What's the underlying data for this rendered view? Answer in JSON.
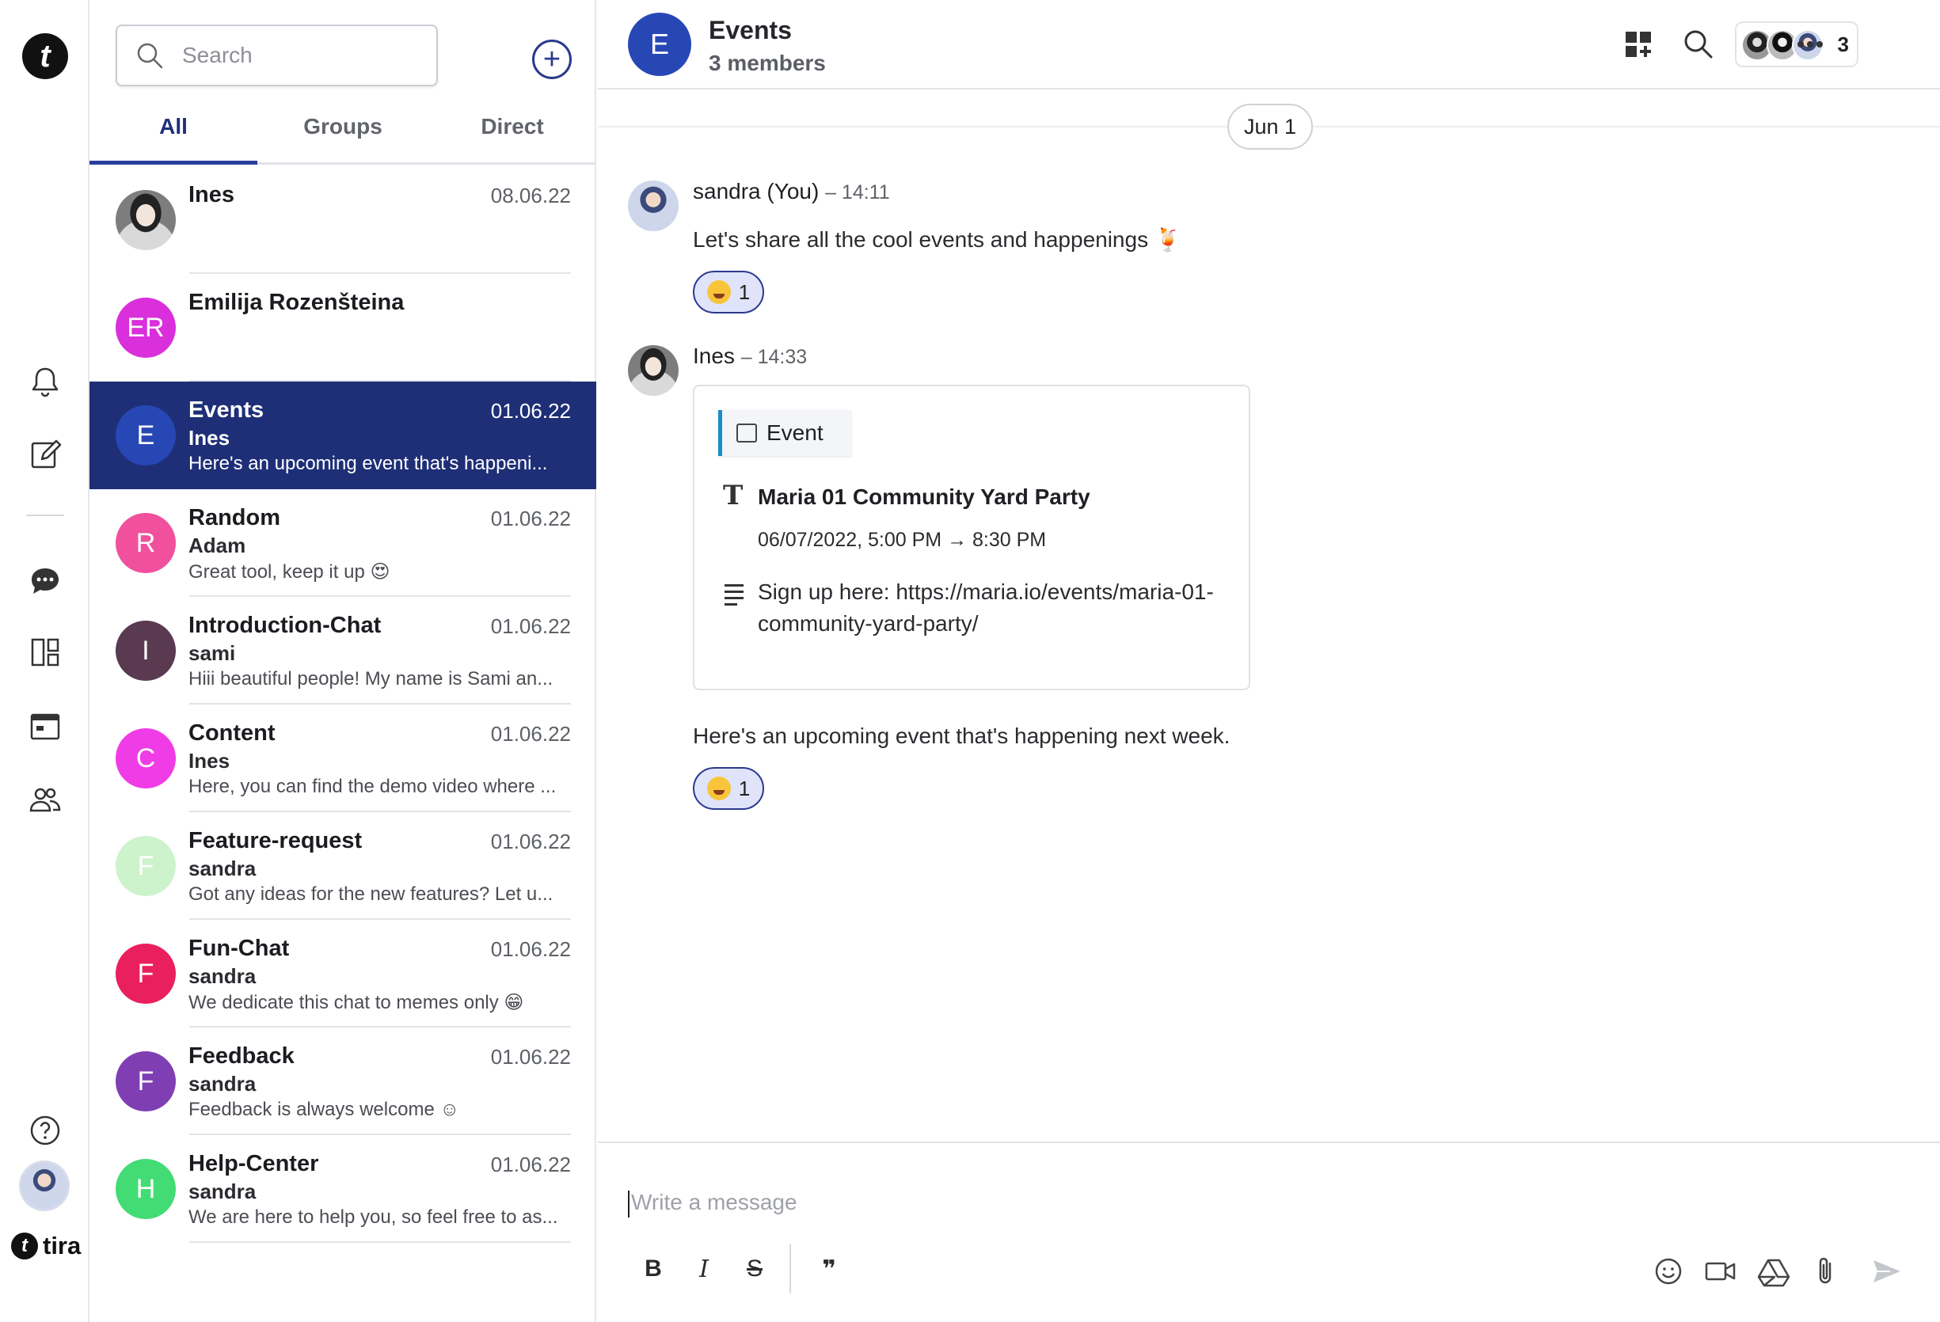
{
  "rail": {
    "logo_letter": "t",
    "brand_name": "tira",
    "icons": [
      "bell-icon",
      "compose-icon",
      "chat-bubble-icon",
      "boards-icon",
      "calendar-icon",
      "people-icon",
      "help-icon"
    ]
  },
  "list": {
    "search_placeholder": "Search",
    "tabs": [
      {
        "label": "All",
        "active": true
      },
      {
        "label": "Groups",
        "active": false
      },
      {
        "label": "Direct",
        "active": false
      }
    ],
    "conversations": [
      {
        "title": "Ines",
        "date": "08.06.22",
        "sender": "",
        "preview": "",
        "initials": "",
        "color": "",
        "photo": true
      },
      {
        "title": "Emilija Rozenšteina",
        "date": "",
        "sender": "",
        "preview": "",
        "initials": "ER",
        "color": "#d930dc"
      },
      {
        "title": "Events",
        "date": "01.06.22",
        "sender": "Ines",
        "preview": "Here's an upcoming event that's happeni...",
        "initials": "E",
        "color": "#2747b5",
        "active": true
      },
      {
        "title": "Random",
        "date": "01.06.22",
        "sender": "Adam",
        "preview": "Great tool, keep it up 😍",
        "initials": "R",
        "color": "#f0509c"
      },
      {
        "title": "Introduction-Chat",
        "date": "01.06.22",
        "sender": "sami",
        "preview": "Hiii beautiful people! My name is Sami an...",
        "initials": "I",
        "color": "#5a3a50"
      },
      {
        "title": "Content",
        "date": "01.06.22",
        "sender": "Ines",
        "preview": "Here, you can find the demo video where ...",
        "initials": "C",
        "color": "#f03ce6"
      },
      {
        "title": "Feature-request",
        "date": "01.06.22",
        "sender": "sandra",
        "preview": "Got any ideas for the new features? Let u...",
        "initials": "F",
        "color": "#cdf3cc"
      },
      {
        "title": "Fun-Chat",
        "date": "01.06.22",
        "sender": "sandra",
        "preview": "We dedicate this chat to memes only 😁",
        "initials": "F",
        "color": "#ea1f5e"
      },
      {
        "title": "Feedback",
        "date": "01.06.22",
        "sender": "sandra",
        "preview": "Feedback is always welcome ☺",
        "initials": "F",
        "color": "#7f3fb3"
      },
      {
        "title": "Help-Center",
        "date": "01.06.22",
        "sender": "sandra",
        "preview": "We are here to help you, so feel free to as...",
        "initials": "H",
        "color": "#43dc74"
      }
    ]
  },
  "header": {
    "initial": "E",
    "name": "Events",
    "members": "3 members",
    "member_count": "3"
  },
  "chat": {
    "date_divider": "Jun 1",
    "messages": [
      {
        "author": "sandra (You)",
        "time": "– 14:11",
        "text": "Let's share all the cool events and happenings 🍹",
        "reaction_count": "1"
      },
      {
        "author": "Ines",
        "time": "– 14:33",
        "text": "Here's an upcoming event that's happening next week.",
        "reaction_count": "1"
      }
    ],
    "event_card": {
      "label": "Event",
      "title": "Maria 01 Community Yard Party",
      "datetime": "06/07/2022, 5:00 PM → 8:30 PM",
      "description": "Sign up here: https://maria.io/events/maria-01-community-yard-party/"
    }
  },
  "composer": {
    "placeholder": "Write a message",
    "bold": "B",
    "italic": "I",
    "strike": "S",
    "quote": "❞"
  },
  "colors": {
    "accent": "#1e2f77",
    "reaction_bg": "#dfe4fb"
  }
}
